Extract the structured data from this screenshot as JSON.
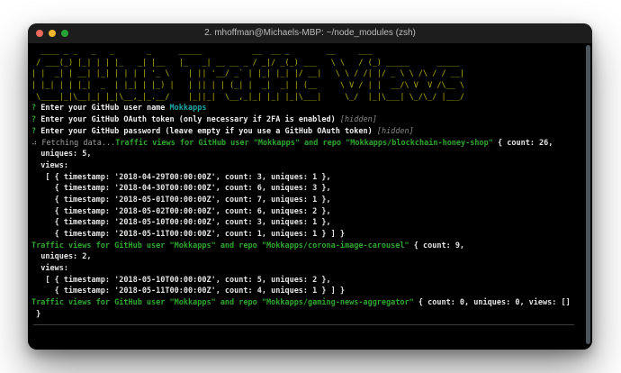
{
  "window": {
    "title": "2. mhoffman@Michaels-MBP: ~/node_modules (zsh)",
    "traffic_lights": [
      "close",
      "minimize",
      "zoom"
    ]
  },
  "colors": {
    "window_background": "#000000",
    "titlebar_background": "#1d1d1d",
    "banner_yellow": "#b7b000",
    "prompt_green": "#2fa62f",
    "answer_cyan": "#1fa8a8",
    "bold_white": "#ededed",
    "muted_gray": "#9f9f9f",
    "light_red": "#ee6a5f",
    "light_yellow": "#f0b72e",
    "light_green": "#28a538"
  },
  "ascii_banner": {
    "text_meaning": "GitHub Traffic Views",
    "lines": [
      "  ____ _ _   _   _       _      _____           __  __ _        __     ___                   ",
      " / ___(_) |_| | | |_   _| |__   |_   _| __ __ _ / _|/ _(_) ___   \\ \\   / (_) _____      _____ ",
      "| |  _| | __| |_| | | | | '_ \\    | || '__/ _` | |_| |_| |/ __|   \\ \\ / /| |/ _ \\ \\ /\\ / / __|",
      "| |_| | | |_|  _  | |_| | |_) |   | || | | (_| |  _|  _| | (__     \\ V / | |  __/\\ V  V /\\__ \\",
      " \\____|_|\\__|_| |_|\\__,_|_.__/    |_||_|  \\__,_|_| |_| |_|\\___|     \\_/  |_|\\___| \\_/\\_/ |___/"
    ]
  },
  "terminal_lines": [
    {
      "segments": [
        {
          "text": "? ",
          "style": "green"
        },
        {
          "text": "Enter your GitHub user name ",
          "style": "white"
        },
        {
          "text": "Mokkapps",
          "style": "cyan"
        }
      ]
    },
    {
      "segments": [
        {
          "text": "? ",
          "style": "green"
        },
        {
          "text": "Enter your GitHub OAuth token (only necessary if 2FA is enabled) ",
          "style": "white"
        },
        {
          "text": "[hidden]",
          "style": "hidden"
        }
      ]
    },
    {
      "segments": [
        {
          "text": "? ",
          "style": "green"
        },
        {
          "text": "Enter your GitHub password (leave empty if you use a GitHub OAuth token) ",
          "style": "white"
        },
        {
          "text": "[hidden]",
          "style": "hidden"
        }
      ]
    },
    {
      "segments": [
        {
          "text": "⠴ Fetching data...",
          "style": "gray"
        },
        {
          "text": "Traffic views for GitHub user \"Mokkapps\" and repo \"Mokkapps/blockchain-honey-shop\"",
          "style": "green"
        },
        {
          "text": " { count: 26,",
          "style": "plain"
        }
      ]
    },
    {
      "segments": [
        {
          "text": "  uniques: 5,",
          "style": "plain"
        }
      ]
    },
    {
      "segments": [
        {
          "text": "  views:",
          "style": "plain"
        }
      ]
    },
    {
      "segments": [
        {
          "text": "   [ { timestamp: '2018-04-29T00:00:00Z', count: 3, uniques: 1 },",
          "style": "plain"
        }
      ]
    },
    {
      "segments": [
        {
          "text": "     { timestamp: '2018-04-30T00:00:00Z', count: 6, uniques: 3 },",
          "style": "plain"
        }
      ]
    },
    {
      "segments": [
        {
          "text": "     { timestamp: '2018-05-01T00:00:00Z', count: 7, uniques: 1 },",
          "style": "plain"
        }
      ]
    },
    {
      "segments": [
        {
          "text": "     { timestamp: '2018-05-02T00:00:00Z', count: 6, uniques: 2 },",
          "style": "plain"
        }
      ]
    },
    {
      "segments": [
        {
          "text": "     { timestamp: '2018-05-10T00:00:00Z', count: 3, uniques: 1 },",
          "style": "plain"
        }
      ]
    },
    {
      "segments": [
        {
          "text": "     { timestamp: '2018-05-11T00:00:00Z', count: 1, uniques: 1 } ] }",
          "style": "plain"
        }
      ]
    },
    {
      "segments": [
        {
          "text": "Traffic views for GitHub user \"Mokkapps\" and repo \"Mokkapps/corona-image-carousel\"",
          "style": "green"
        },
        {
          "text": " { count: 9,",
          "style": "plain"
        }
      ]
    },
    {
      "segments": [
        {
          "text": "  uniques: 2,",
          "style": "plain"
        }
      ]
    },
    {
      "segments": [
        {
          "text": "  views:",
          "style": "plain"
        }
      ]
    },
    {
      "segments": [
        {
          "text": "   [ { timestamp: '2018-05-10T00:00:00Z', count: 5, uniques: 2 },",
          "style": "plain"
        }
      ]
    },
    {
      "segments": [
        {
          "text": "     { timestamp: '2018-05-11T00:00:00Z', count: 4, uniques: 1 } ] }",
          "style": "plain"
        }
      ]
    },
    {
      "segments": [
        {
          "text": "Traffic views for GitHub user \"Mokkapps\" and repo \"Mokkapps/gaming-news-aggregator\"",
          "style": "green"
        },
        {
          "text": " { count: 0, uniques: 0, views: []",
          "style": "plain"
        }
      ]
    },
    {
      "segments": [
        {
          "text": " }",
          "style": "plain"
        }
      ]
    }
  ]
}
